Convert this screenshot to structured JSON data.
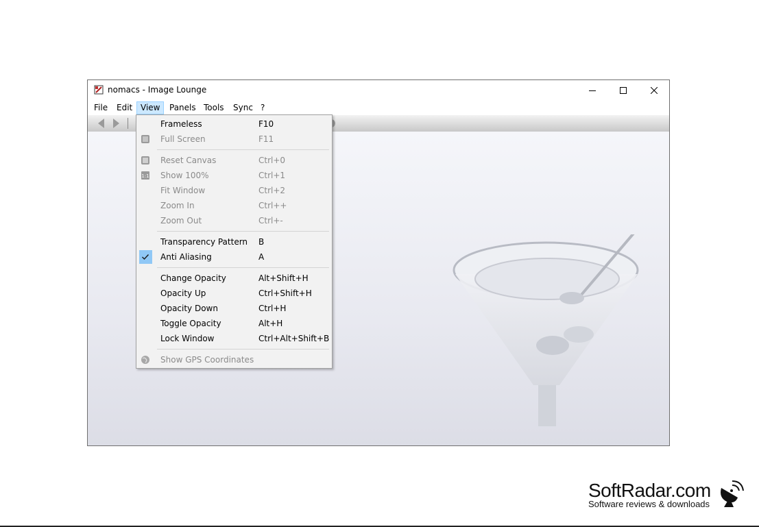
{
  "window": {
    "title": "nomacs - Image Lounge",
    "controls": {
      "minimize_icon": "minimize-icon",
      "maximize_icon": "maximize-icon",
      "close_icon": "close-icon"
    }
  },
  "menubar": {
    "items": [
      {
        "label": "File"
      },
      {
        "label": "Edit"
      },
      {
        "label": "View",
        "active": true
      },
      {
        "label": "Panels"
      },
      {
        "label": "Tools"
      },
      {
        "label": "Sync"
      },
      {
        "label": "?"
      }
    ]
  },
  "view_menu": {
    "items": [
      {
        "label": "Frameless",
        "shortcut": "F10",
        "enabled": true
      },
      {
        "label": "Full Screen",
        "shortcut": "F11",
        "enabled": false,
        "icon": "fullscreen-icon"
      },
      {
        "label": "Reset Canvas",
        "shortcut": "Ctrl+0",
        "enabled": false,
        "icon": "reset-canvas-icon"
      },
      {
        "label": "Show 100%",
        "shortcut": "Ctrl+1",
        "enabled": false,
        "icon": "one-to-one-icon"
      },
      {
        "label": "Fit Window",
        "shortcut": "Ctrl+2",
        "enabled": false
      },
      {
        "label": "Zoom In",
        "shortcut": "Ctrl++",
        "enabled": false
      },
      {
        "label": "Zoom Out",
        "shortcut": "Ctrl+-",
        "enabled": false
      },
      {
        "label": "Transparency Pattern",
        "shortcut": "B",
        "enabled": true
      },
      {
        "label": "Anti Aliasing",
        "shortcut": "A",
        "enabled": true,
        "checked": true
      },
      {
        "label": "Change Opacity",
        "shortcut": "Alt+Shift+H",
        "enabled": true
      },
      {
        "label": "Opacity Up",
        "shortcut": "Ctrl+Shift+H",
        "enabled": true
      },
      {
        "label": "Opacity Down",
        "shortcut": "Ctrl+H",
        "enabled": true
      },
      {
        "label": "Toggle Opacity",
        "shortcut": "Alt+H",
        "enabled": true
      },
      {
        "label": "Lock Window",
        "shortcut": "Ctrl+Alt+Shift+B",
        "enabled": true
      },
      {
        "label": "Show GPS Coordinates",
        "shortcut": "",
        "enabled": false,
        "icon": "globe-icon"
      }
    ]
  },
  "watermark": {
    "title": "SoftRadar.com",
    "subtitle": "Software reviews & downloads"
  },
  "colors": {
    "menu_highlight": "#cce8ff",
    "check_bg": "#90c8f6",
    "disabled_text": "#8a8a8a"
  }
}
